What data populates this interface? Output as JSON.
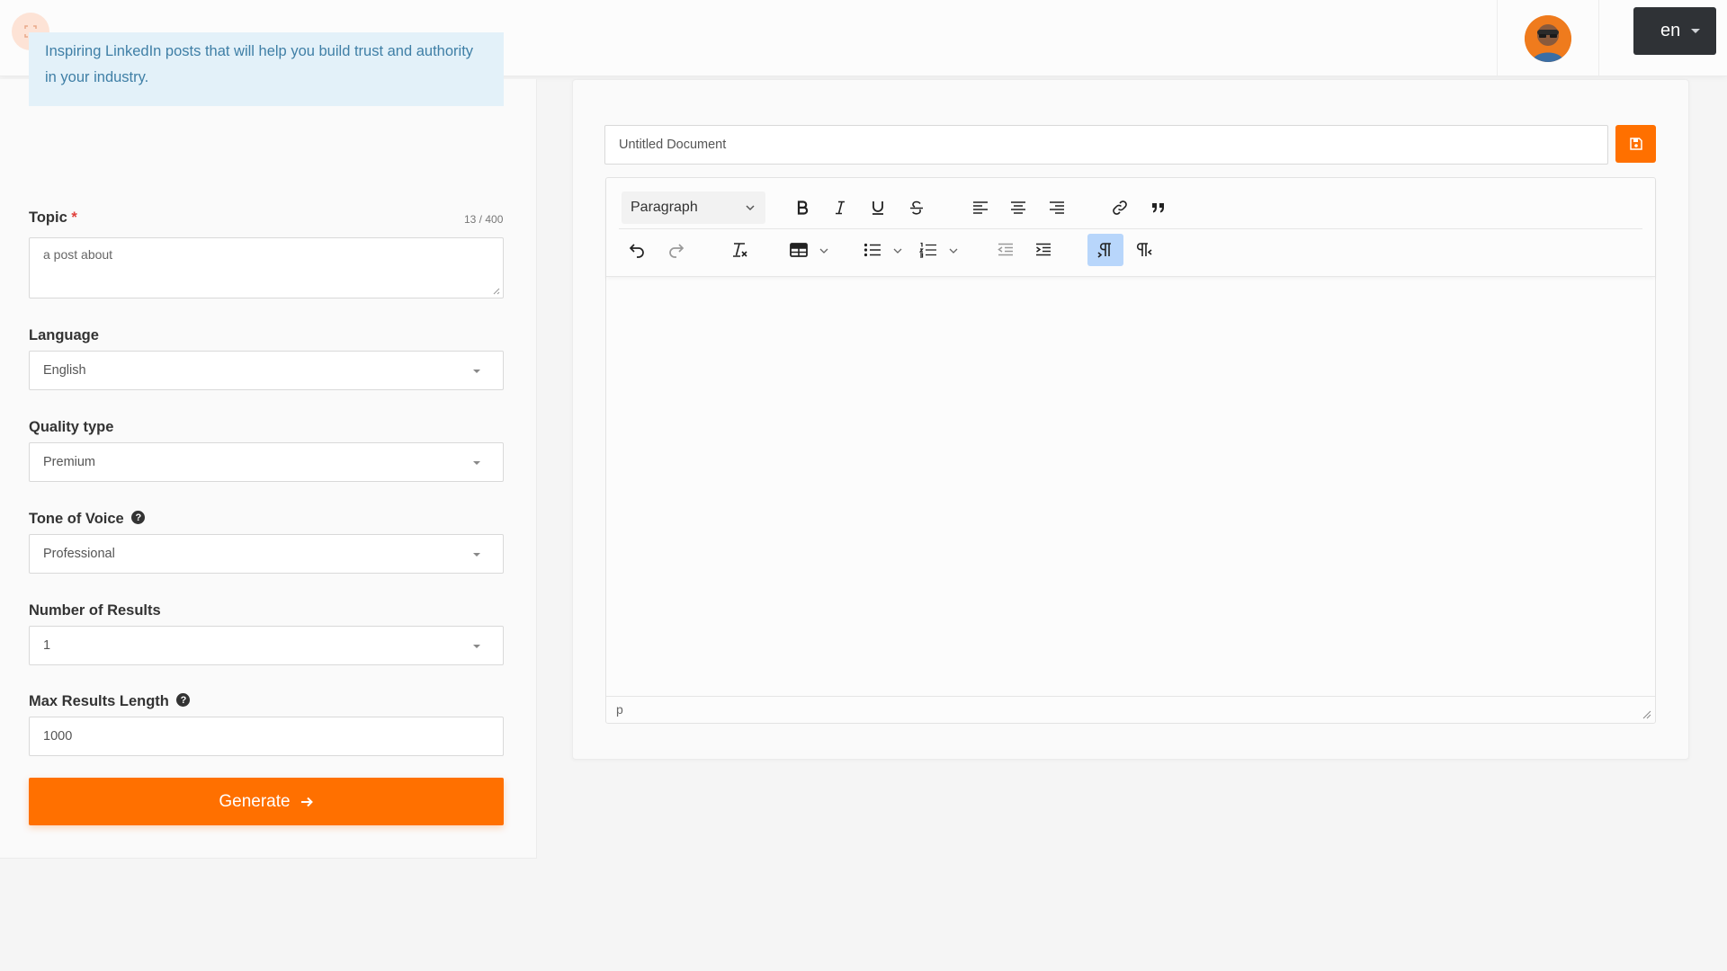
{
  "header": {
    "expand_icon": "expand-icon",
    "avatar_icon": "user-avatar",
    "language_button": "en"
  },
  "form": {
    "intro": "Inspiring LinkedIn posts that will help you build trust and authority in your industry.",
    "topic": {
      "label": "Topic",
      "required_mark": "*",
      "counter": "13 / 400",
      "value": "a post about"
    },
    "language": {
      "label": "Language",
      "value": "English"
    },
    "quality": {
      "label": "Quality type",
      "value": "Premium"
    },
    "tone": {
      "label": "Tone of Voice",
      "value": "Professional",
      "help": "?"
    },
    "results": {
      "label": "Number of Results",
      "value": "1"
    },
    "max_length": {
      "label": "Max Results Length",
      "value": "1000",
      "help": "?"
    },
    "generate_label": "Generate",
    "generate_icon": "arrow-right-icon",
    "accent_color": "#ff7000",
    "info_bg": "#e3f1f9"
  },
  "editor": {
    "document_title": "Untitled Document",
    "save_icon": "save-icon",
    "block_format": "Paragraph",
    "status_path": "p",
    "toolbar_icons": [
      "bold-icon",
      "italic-icon",
      "underline-icon",
      "strikethrough-icon",
      "align-left-icon",
      "align-center-icon",
      "align-right-icon",
      "link-icon",
      "blockquote-icon",
      "undo-icon",
      "redo-icon",
      "clear-format-icon",
      "table-icon",
      "bullet-list-icon",
      "numbered-list-icon",
      "outdent-icon",
      "indent-icon",
      "ltr-icon",
      "rtl-icon"
    ],
    "active_tool": "ltr-icon"
  }
}
